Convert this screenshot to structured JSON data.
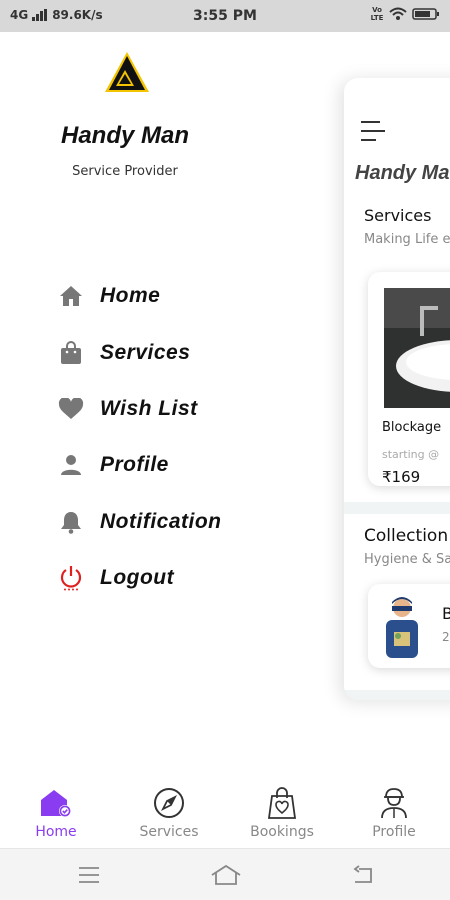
{
  "status_bar": {
    "network": "4G",
    "speed": "89.6K/s",
    "time": "3:55 PM",
    "volte": "Vo LTE"
  },
  "drawer": {
    "app_name": "Handy Man",
    "subtitle": "Service Provider",
    "menu": [
      {
        "label": "Home",
        "icon": "home-icon"
      },
      {
        "label": "Services",
        "icon": "bag-icon"
      },
      {
        "label": "Wish List",
        "icon": "heart-icon"
      },
      {
        "label": "Profile",
        "icon": "person-icon"
      },
      {
        "label": "Notification",
        "icon": "bell-icon"
      },
      {
        "label": "Logout",
        "icon": "power-icon"
      }
    ]
  },
  "preview": {
    "title": "Handy Ma",
    "services": {
      "title": "Services",
      "subtitle": "Making Life e",
      "card": {
        "title": "Blockage",
        "starting": "starting @",
        "price": "₹169"
      }
    },
    "collection": {
      "title": "Collection",
      "subtitle": "Hygiene & Sa",
      "card": {
        "letter": "B",
        "number": "2"
      }
    }
  },
  "bottom_nav": [
    {
      "label": "Home",
      "icon": "home-badge-icon",
      "active": true
    },
    {
      "label": "Services",
      "icon": "compass-icon",
      "active": false
    },
    {
      "label": "Bookings",
      "icon": "shopping-bag-icon",
      "active": false
    },
    {
      "label": "Profile",
      "icon": "worker-icon",
      "active": false
    }
  ],
  "colors": {
    "accent": "#8a3df0",
    "logout_red": "#e02020",
    "icon_gray": "#777777",
    "logo_yellow": "#f5c400"
  }
}
